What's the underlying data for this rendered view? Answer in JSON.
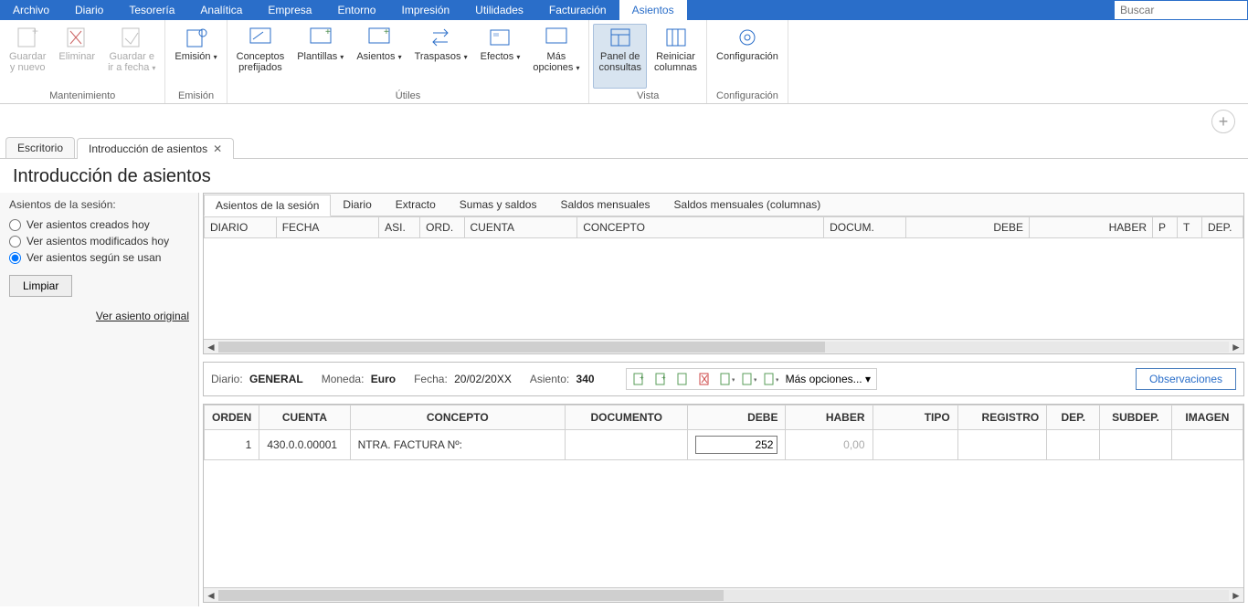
{
  "menu": {
    "items": [
      "Archivo",
      "Diario",
      "Tesorería",
      "Analítica",
      "Empresa",
      "Entorno",
      "Impresión",
      "Utilidades",
      "Facturación",
      "Asientos"
    ],
    "active": "Asientos",
    "search_placeholder": "Buscar"
  },
  "ribbon": {
    "groups": [
      {
        "label": "Mantenimiento",
        "buttons": [
          {
            "label": "Guardar\ny nuevo",
            "icon": "save-new-icon",
            "enabled": false,
            "dd": false
          },
          {
            "label": "Eliminar",
            "icon": "delete-icon",
            "enabled": false,
            "dd": false
          },
          {
            "label": "Guardar e\nir a fecha",
            "icon": "save-goto-icon",
            "enabled": false,
            "dd": true
          }
        ]
      },
      {
        "label": "Emisión",
        "buttons": [
          {
            "label": "Emisión",
            "icon": "emit-icon",
            "enabled": true,
            "dd": true
          }
        ]
      },
      {
        "label": "Útiles",
        "buttons": [
          {
            "label": "Conceptos\nprefijados",
            "icon": "concepts-icon",
            "enabled": true,
            "dd": false
          },
          {
            "label": "Plantillas",
            "icon": "templates-icon",
            "enabled": true,
            "dd": true
          },
          {
            "label": "Asientos",
            "icon": "entries-icon",
            "enabled": true,
            "dd": true
          },
          {
            "label": "Traspasos",
            "icon": "transfers-icon",
            "enabled": true,
            "dd": true
          },
          {
            "label": "Efectos",
            "icon": "effects-icon",
            "enabled": true,
            "dd": true
          },
          {
            "label": "Más\nopciones",
            "icon": "more-icon",
            "enabled": true,
            "dd": true
          }
        ]
      },
      {
        "label": "Vista",
        "buttons": [
          {
            "label": "Panel de\nconsultas",
            "icon": "panel-icon",
            "enabled": true,
            "dd": false,
            "active": true
          },
          {
            "label": "Reiniciar\ncolumnas",
            "icon": "reset-cols-icon",
            "enabled": true,
            "dd": false
          }
        ]
      },
      {
        "label": "Configuración",
        "buttons": [
          {
            "label": "Configuración",
            "icon": "config-icon",
            "enabled": true,
            "dd": false
          }
        ]
      }
    ]
  },
  "doc_tabs": {
    "items": [
      {
        "label": "Escritorio",
        "close": false
      },
      {
        "label": "Introducción de asientos",
        "close": true
      }
    ],
    "active_index": 1
  },
  "page_title": "Introducción de asientos",
  "sidebar": {
    "title": "Asientos de la sesión:",
    "radios": [
      {
        "label": "Ver asientos creados hoy",
        "checked": false
      },
      {
        "label": "Ver asientos modificados hoy",
        "checked": false
      },
      {
        "label": "Ver asientos según se usan",
        "checked": true
      }
    ],
    "clear_btn": "Limpiar",
    "link": "Ver asiento original"
  },
  "inner_tabs": [
    "Asientos de la sesión",
    "Diario",
    "Extracto",
    "Sumas y saldos",
    "Saldos mensuales",
    "Saldos mensuales (columnas)"
  ],
  "inner_tabs_active": 0,
  "grid_headers": [
    "DIARIO",
    "FECHA",
    "ASI.",
    "ORD.",
    "CUENTA",
    "CONCEPTO",
    "DOCUM.",
    "DEBE",
    "HABER",
    "P",
    "T",
    "DEP."
  ],
  "info": {
    "diario_lbl": "Diario:",
    "diario_val": "GENERAL",
    "moneda_lbl": "Moneda:",
    "moneda_val": "Euro",
    "fecha_lbl": "Fecha:",
    "fecha_val": "20/02/20XX",
    "asiento_lbl": "Asiento:",
    "asiento_val": "340",
    "more_opts": "Más opciones...",
    "obsv": "Observaciones"
  },
  "entry": {
    "headers": [
      "ORDEN",
      "CUENTA",
      "CONCEPTO",
      "DOCUMENTO",
      "DEBE",
      "HABER",
      "TIPO",
      "REGISTRO",
      "DEP.",
      "SUBDEP.",
      "IMAGEN"
    ],
    "row": {
      "orden": "1",
      "cuenta": "430.0.0.00001",
      "concepto": "NTRA. FACTURA Nº:",
      "documento": "",
      "debe": "252",
      "haber": "0,00",
      "tipo": "",
      "registro": "",
      "dep": "",
      "subdep": "",
      "imagen": ""
    }
  }
}
